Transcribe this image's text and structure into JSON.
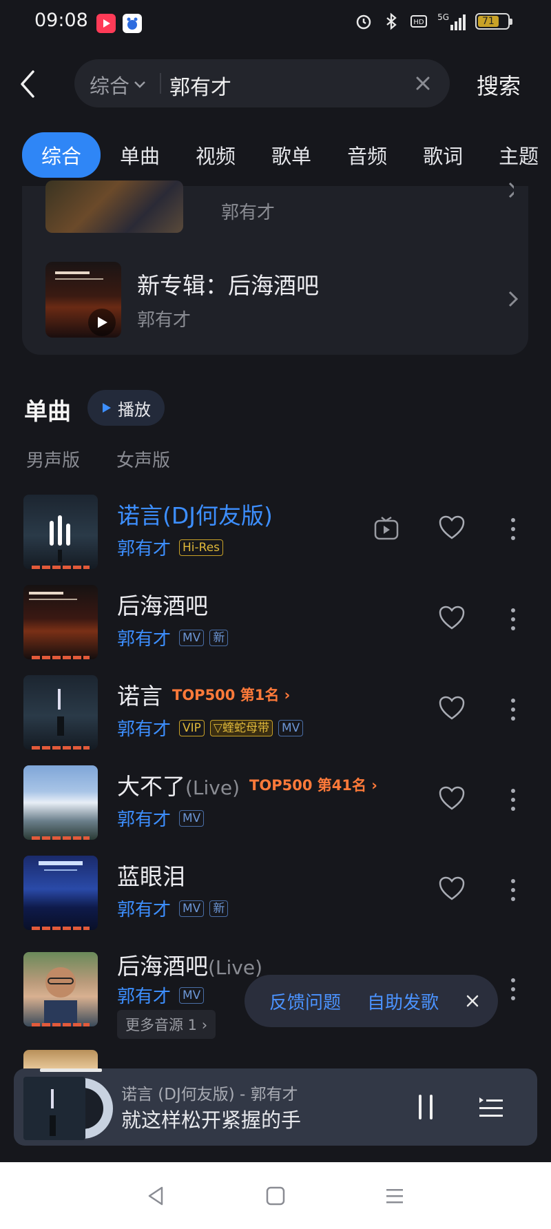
{
  "status_bar": {
    "time": "09:08",
    "battery": "71",
    "network": "5G",
    "icons": [
      "alarm-icon",
      "bluetooth-icon",
      "hd-icon",
      "signal-icon",
      "battery-icon"
    ]
  },
  "search": {
    "type_label": "综合",
    "query": "郭有才",
    "submit_label": "搜索"
  },
  "tabs": [
    "综合",
    "单曲",
    "视频",
    "歌单",
    "音频",
    "歌词",
    "主题"
  ],
  "albums": [
    {
      "title": "",
      "artist": "郭有才"
    },
    {
      "title": "新专辑：后海酒吧",
      "artist": "郭有才"
    }
  ],
  "singles": {
    "title": "单曲",
    "play_label": "播放",
    "filters": [
      "男声版",
      "女声版"
    ],
    "songs": [
      {
        "title": "诺言(DJ何友版)",
        "artist": "郭有才",
        "tags": [
          "Hi-Res"
        ]
      },
      {
        "title": "后海酒吧",
        "artist": "郭有才",
        "tags": [
          "MV",
          "新"
        ]
      },
      {
        "title": "诺言",
        "rank": "TOP500 第1名",
        "artist": "郭有才",
        "tags": [
          "VIP",
          "蝰蛇母带",
          "MV"
        ]
      },
      {
        "title": "大不了",
        "suffix": "(Live)",
        "rank": "TOP500 第41名",
        "artist": "郭有才",
        "tags": [
          "MV"
        ]
      },
      {
        "title": "蓝眼泪",
        "artist": "郭有才",
        "tags": [
          "MV",
          "新"
        ]
      },
      {
        "title": "后海酒吧",
        "suffix": "(Live)",
        "artist": "郭有才",
        "tags": [
          "MV"
        ],
        "more_sources": "更多音源 1"
      }
    ]
  },
  "feedback": {
    "report": "反馈问题",
    "publish": "自助发歌"
  },
  "player": {
    "song_line": "诺言 (DJ何友版)  -  郭有才",
    "lyric": "就这样松开紧握的手"
  }
}
